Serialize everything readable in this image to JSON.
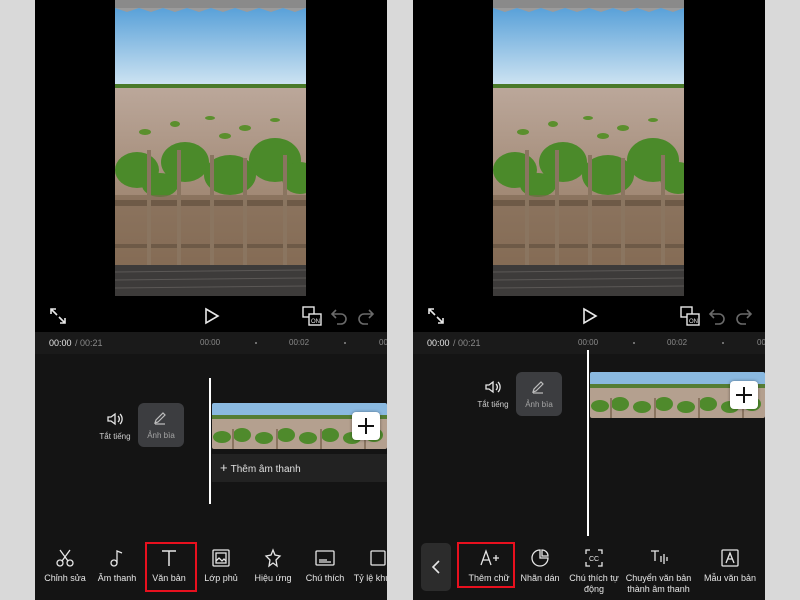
{
  "panels": {
    "left": {
      "time": {
        "current": "00:00",
        "total": "/ 00:21"
      },
      "ticks": [
        "00:00",
        "00:02",
        "00"
      ],
      "mute_label": "Tắt tiếng",
      "cover_label": "Ảnh bìa",
      "add_audio_label": "Thêm âm thanh",
      "tools": [
        "Chỉnh sửa",
        "Âm thanh",
        "Văn bản",
        "Lớp phủ",
        "Hiệu ứng",
        "Chú thích",
        "Tỷ lệ khung"
      ],
      "highlighted_tool": "Văn bản"
    },
    "right": {
      "time": {
        "current": "00:00",
        "total": "/ 00:21"
      },
      "ticks": [
        "00:00",
        "00:02",
        "00"
      ],
      "mute_label": "Tắt tiếng",
      "cover_label": "Ảnh bìa",
      "tools": [
        "Thêm chữ",
        "Nhãn dán",
        "Chú thích tự động",
        "Chuyển văn bản thành âm thanh",
        "Mẫu văn bản"
      ],
      "highlighted_tool": "Thêm chữ"
    }
  },
  "colors": {
    "highlight": "#e8101e",
    "panel_bg": "#141414",
    "page_bg": "#d9d9d9"
  },
  "icons": {
    "preview_controls": [
      "fullscreen-icon",
      "play-icon",
      "crop-on-icon",
      "undo-icon",
      "redo-icon"
    ],
    "left_tools": [
      "scissors-icon",
      "music-note-icon",
      "text-t-icon",
      "overlay-icon",
      "effects-star-icon",
      "caption-icon",
      "ratio-icon"
    ],
    "right_tools": [
      "add-text-icon",
      "sticker-icon",
      "auto-caption-icon",
      "text-to-speech-icon",
      "text-template-icon"
    ]
  }
}
